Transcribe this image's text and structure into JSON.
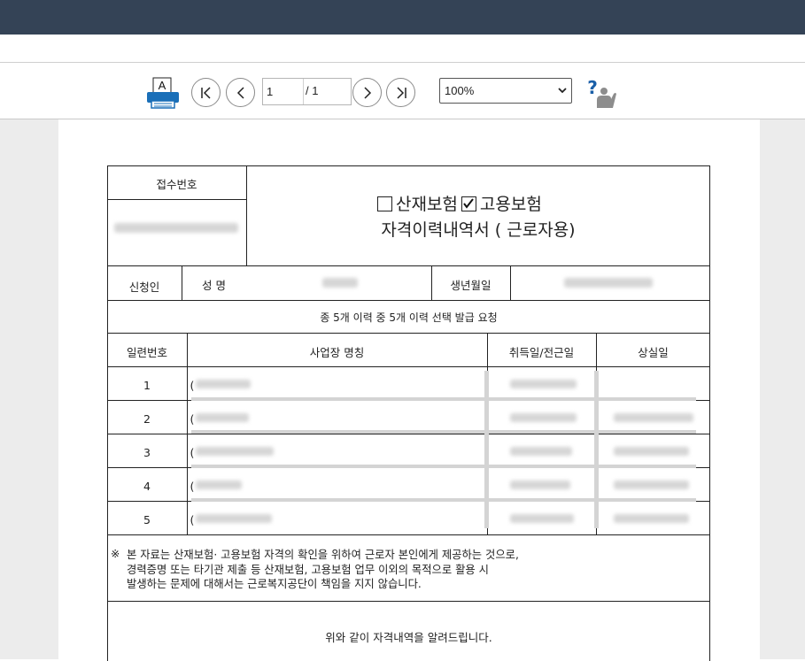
{
  "toolbar": {
    "printer_icon_letter": "A",
    "first_page_icon": "first-page-icon",
    "prev_page_icon": "prev-page-icon",
    "next_page_icon": "next-page-icon",
    "last_page_icon": "last-page-icon",
    "current_page": "1",
    "total_pages": "/ 1",
    "zoom": "100%",
    "help_icon": "help-icon"
  },
  "form": {
    "receipt_label": "접수번호",
    "check_industrial": "산재보험",
    "check_employment": "고용보험",
    "check_industrial_state": "unchecked",
    "check_employment_state": "checked",
    "title_line2": "자격이력내역서 ( 근로자용)",
    "applicant_label": "신청인",
    "name_label": "성 명",
    "birth_label": "생년월일",
    "summary": "종 5개 이력 중 5개 이력 선택 발급 요청",
    "headers": [
      "일련번호",
      "사업장 명칭",
      "취득일/전근일",
      "상실일"
    ],
    "rows": [
      {
        "no": "1",
        "name_prefix": "("
      },
      {
        "no": "2",
        "name_prefix": "("
      },
      {
        "no": "3",
        "name_prefix": "("
      },
      {
        "no": "4",
        "name_prefix": "("
      },
      {
        "no": "5",
        "name_prefix": "("
      }
    ],
    "notice_mark": "※",
    "notice_line1": "본 자료는 산재보험· 고용보험 자격의 확인을 위하여 근로자 본인에게 제공하는 것으로,",
    "notice_line2": "경력증명 또는 타기관 제출 등 산재보험, 고용보험 업무 이외의 목적으로 활용 시",
    "notice_line3": "발생하는 문제에 대해서는 근로복지공단이 책임을 지지 않습니다.",
    "footer": "위와 같이 자격내역을 알려드립니다."
  },
  "colors": {
    "topbar": "#344356",
    "workarea": "#ececec",
    "printer_blue": "#1a6fb8"
  }
}
